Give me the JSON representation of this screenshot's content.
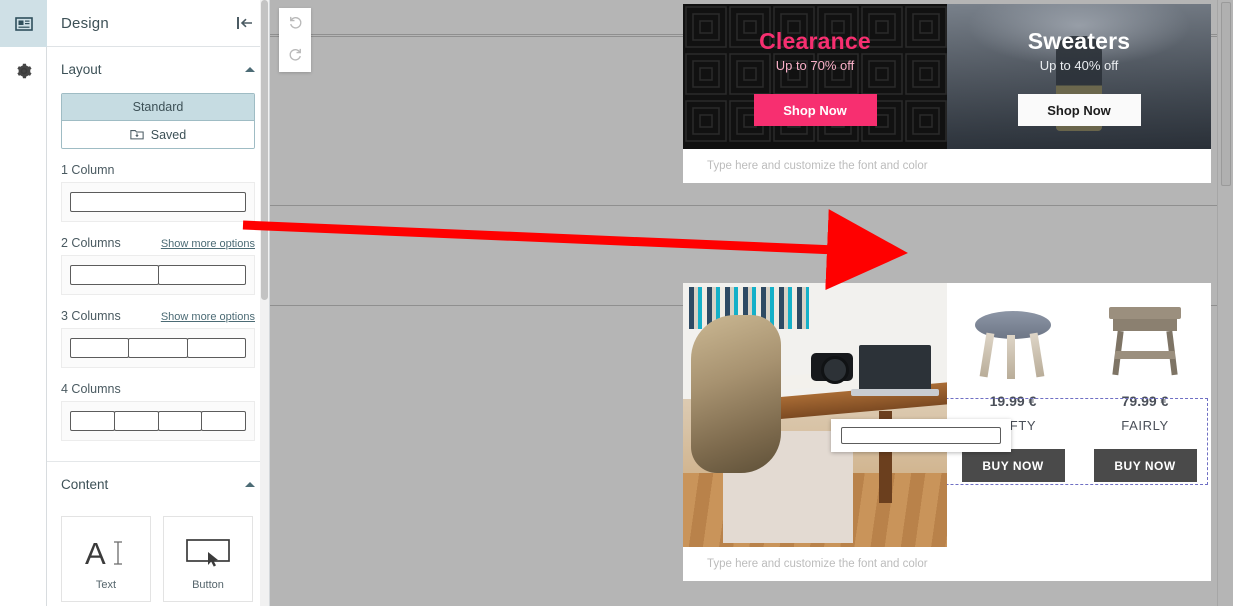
{
  "rail": {
    "items": [
      {
        "name": "design-icon",
        "label": "Design",
        "active": true
      },
      {
        "name": "settings-icon",
        "label": "Settings",
        "active": false
      }
    ]
  },
  "panel": {
    "title": "Design",
    "collapse_label": "Collapse panel",
    "sections": {
      "layout": {
        "title": "Layout",
        "tabs": [
          {
            "label": "Standard",
            "active": true
          },
          {
            "label": "Saved",
            "active": false,
            "icon": "folder-down-icon"
          }
        ],
        "groups": [
          {
            "label": "1 Column",
            "columns": 1,
            "more_options": null
          },
          {
            "label": "2 Columns",
            "columns": 2,
            "more_options": "Show more options"
          },
          {
            "label": "3 Columns",
            "columns": 3,
            "more_options": "Show more options"
          },
          {
            "label": "4 Columns",
            "columns": 4,
            "more_options": null
          }
        ]
      },
      "content": {
        "title": "Content",
        "items": [
          {
            "label": "Text",
            "icon": "text-cursor-icon"
          },
          {
            "label": "Button",
            "icon": "button-pointer-icon"
          }
        ]
      }
    }
  },
  "toolbar": {
    "undo_label": "Undo",
    "redo_label": "Redo"
  },
  "canvas": {
    "heroes": [
      {
        "title": "Clearance",
        "subtitle": "Up to 70% off",
        "button": "Shop Now",
        "title_color": "#f72f70",
        "button_bg": "#f72f70",
        "button_color": "#ffffff",
        "background": "#0f0f0f",
        "style": "pattern"
      },
      {
        "title": "Sweaters",
        "subtitle": "Up to 40% off",
        "button": "Shop Now",
        "title_color": "#ffffff",
        "button_bg": "#fafafa",
        "button_color": "#1d1d1d",
        "background": "#4a525c",
        "style": "photo"
      }
    ],
    "hero_caption": "Type here and customize the font and color",
    "drop_zone": {
      "label": "Drop zone",
      "border_color": "#6f6fc4"
    },
    "dragged_widget": {
      "label": "1 Column",
      "columns": 1
    },
    "products": [
      {
        "price": "19.99 €",
        "name": "SOFTY",
        "button": "BUY NOW",
        "image": "stool"
      },
      {
        "price": "79.99 €",
        "name": "FAIRLY",
        "button": "BUY NOW",
        "image": "side-table"
      }
    ],
    "product_caption": "Type here and customize the font and color"
  },
  "annotation": {
    "arrow_color": "#ff0000",
    "from": "1-column-layout-widget",
    "to": "drop-zone"
  }
}
